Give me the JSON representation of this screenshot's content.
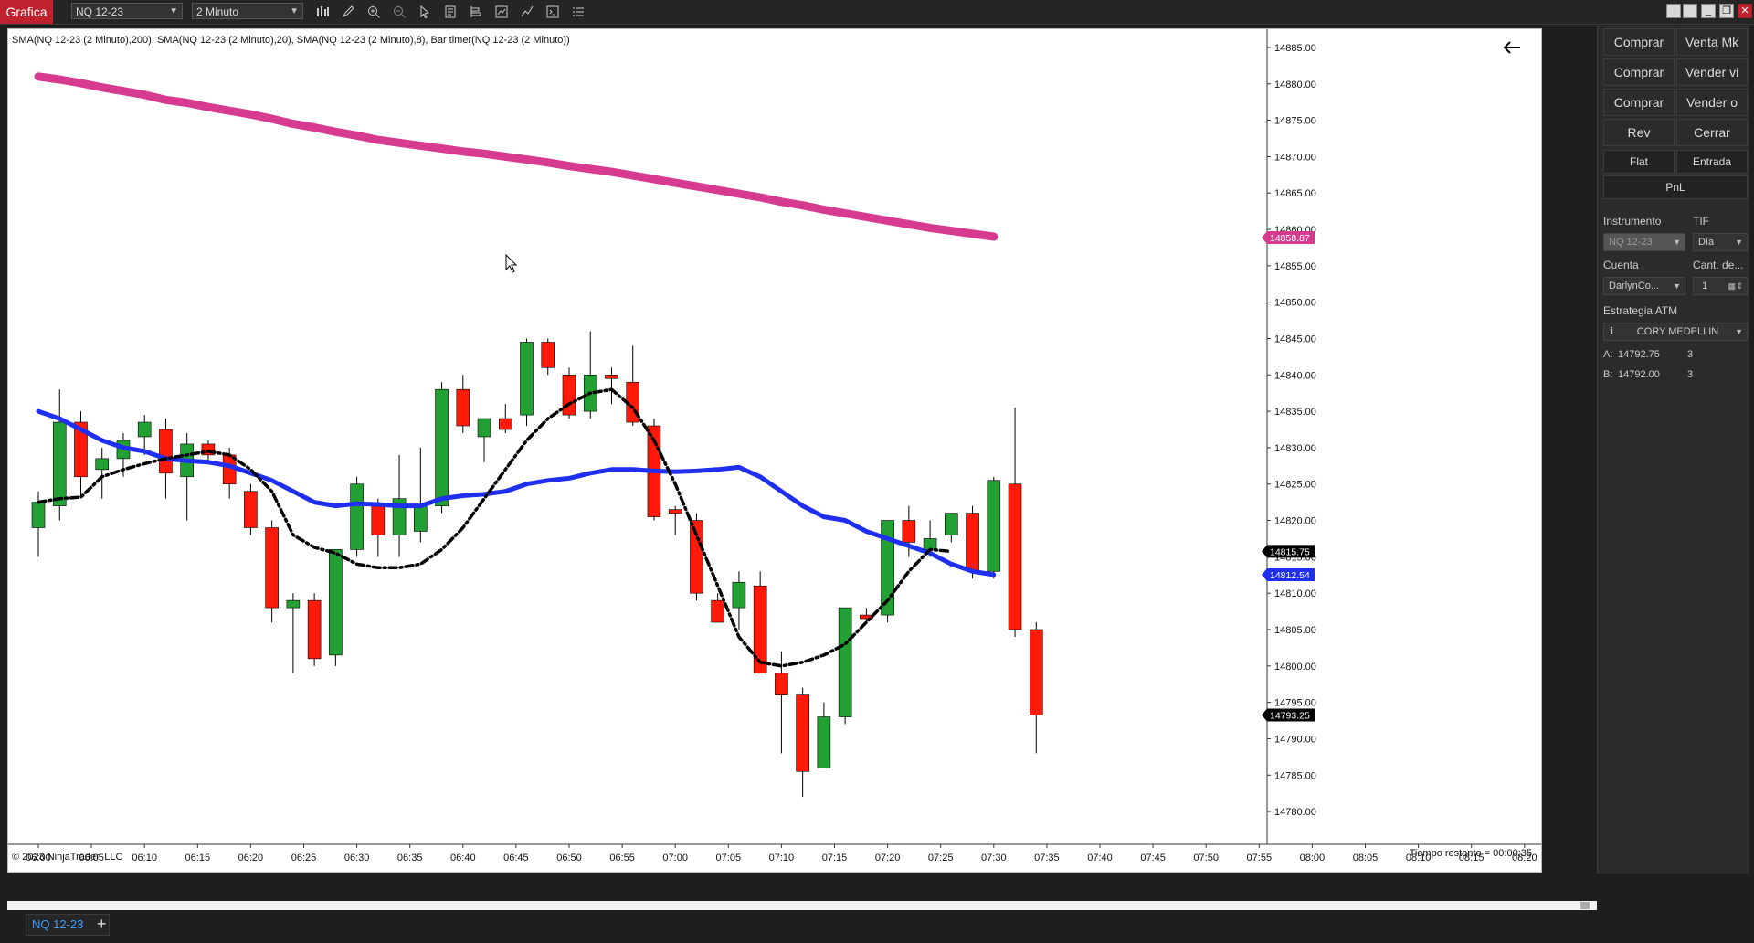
{
  "app": {
    "title": "Grafica"
  },
  "toolbar": {
    "instrument": "NQ 12-23",
    "interval": "2 Minuto",
    "tools": [
      "bars-icon",
      "pencil-icon",
      "zoom-in-icon",
      "zoom-out-icon",
      "cursor-icon",
      "template-icon",
      "properties-icon",
      "data-box-icon",
      "strategy-icon",
      "chart-trader-icon",
      "more-icon"
    ]
  },
  "chart": {
    "legend_text": "SMA(NQ 12-23 (2 Minuto),200), SMA(NQ 12-23 (2 Minuto),20), SMA(NQ 12-23 (2 Minuto),8), Bar timer(NQ 12-23 (2 Minuto))",
    "copyright": "© 2023 NinjaTrader, LLC",
    "bar_timer": "Tiempo restante = 00:00:35",
    "colors": {
      "up": "#22a033",
      "down": "#ff1a0a",
      "sma200": "#d63b8f",
      "sma20": "#1f2ff0",
      "sma8": "#000000"
    }
  },
  "chart_data": {
    "type": "candlestick",
    "instrument": "NQ 12-23",
    "interval": "2 Minuto",
    "yticks": [
      "14885.00",
      "14880.00",
      "14875.00",
      "14870.00",
      "14865.00",
      "14860.00",
      "14855.00",
      "14850.00",
      "14845.00",
      "14840.00",
      "14835.00",
      "14830.00",
      "14825.00",
      "14820.00",
      "14815.00",
      "14810.00",
      "14805.00",
      "14800.00",
      "14795.00",
      "14790.00",
      "14785.00",
      "14780.00"
    ],
    "ylim": [
      14778,
      14886.5
    ],
    "xticks": [
      "06:00",
      "06:05",
      "06:10",
      "06:15",
      "06:20",
      "06:25",
      "06:30",
      "06:35",
      "06:40",
      "06:45",
      "06:50",
      "06:55",
      "07:00",
      "07:05",
      "07:10",
      "07:15",
      "07:20",
      "07:25",
      "07:30",
      "07:35",
      "07:40",
      "07:45",
      "07:50",
      "07:55",
      "08:00",
      "08:05",
      "08:10",
      "08:15",
      "08:20"
    ],
    "candles": [
      {
        "time": "06:00",
        "open": 14819,
        "high": 14824,
        "low": 14815,
        "close": 14822.5
      },
      {
        "time": "06:02",
        "open": 14822,
        "high": 14838,
        "low": 14820,
        "close": 14833.5
      },
      {
        "time": "06:04",
        "open": 14833.5,
        "high": 14835,
        "low": 14823,
        "close": 14826
      },
      {
        "time": "06:06",
        "open": 14827,
        "high": 14830,
        "low": 14823,
        "close": 14828.5
      },
      {
        "time": "06:08",
        "open": 14828.5,
        "high": 14832,
        "low": 14826,
        "close": 14831
      },
      {
        "time": "06:10",
        "open": 14831.5,
        "high": 14834.5,
        "low": 14829,
        "close": 14833.5
      },
      {
        "time": "06:12",
        "open": 14832.5,
        "high": 14834,
        "low": 14823,
        "close": 14826.5
      },
      {
        "time": "06:14",
        "open": 14826,
        "high": 14832,
        "low": 14820,
        "close": 14830.5
      },
      {
        "time": "06:16",
        "open": 14830.5,
        "high": 14831,
        "low": 14828,
        "close": 14829
      },
      {
        "time": "06:18",
        "open": 14829,
        "high": 14830,
        "low": 14823,
        "close": 14825
      },
      {
        "time": "06:20",
        "open": 14824,
        "high": 14825,
        "low": 14818,
        "close": 14819
      },
      {
        "time": "06:22",
        "open": 14819,
        "high": 14820,
        "low": 14806,
        "close": 14808
      },
      {
        "time": "06:24",
        "open": 14808,
        "high": 14810,
        "low": 14799,
        "close": 14809
      },
      {
        "time": "06:26",
        "open": 14809,
        "high": 14810,
        "low": 14800,
        "close": 14801
      },
      {
        "time": "06:28",
        "open": 14801.5,
        "high": 14811,
        "low": 14800,
        "close": 14816
      },
      {
        "time": "06:30",
        "open": 14816,
        "high": 14826,
        "low": 14815,
        "close": 14825
      },
      {
        "time": "06:32",
        "open": 14822,
        "high": 14823,
        "low": 14815,
        "close": 14818
      },
      {
        "time": "06:34",
        "open": 14818,
        "high": 14829,
        "low": 14815,
        "close": 14823
      },
      {
        "time": "06:36",
        "open": 14818.5,
        "high": 14830,
        "low": 14817,
        "close": 14822
      },
      {
        "time": "06:38",
        "open": 14822,
        "high": 14839,
        "low": 14821,
        "close": 14838
      },
      {
        "time": "06:40",
        "open": 14838,
        "high": 14840,
        "low": 14832,
        "close": 14833
      },
      {
        "time": "06:42",
        "open": 14831.5,
        "high": 14834,
        "low": 14828,
        "close": 14834
      },
      {
        "time": "06:44",
        "open": 14834,
        "high": 14836,
        "low": 14832,
        "close": 14832.5
      },
      {
        "time": "06:46",
        "open": 14834.5,
        "high": 14845,
        "low": 14833,
        "close": 14844.5
      },
      {
        "time": "06:48",
        "open": 14844.5,
        "high": 14845,
        "low": 14840,
        "close": 14841
      },
      {
        "time": "06:50",
        "open": 14840,
        "high": 14841,
        "low": 14834,
        "close": 14834.5
      },
      {
        "time": "06:52",
        "open": 14835,
        "high": 14846,
        "low": 14834,
        "close": 14840
      },
      {
        "time": "06:54",
        "open": 14840,
        "high": 14841,
        "low": 14836,
        "close": 14839.5
      },
      {
        "time": "06:56",
        "open": 14839,
        "high": 14844,
        "low": 14833,
        "close": 14833.5
      },
      {
        "time": "06:58",
        "open": 14833,
        "high": 14834,
        "low": 14820,
        "close": 14820.5
      },
      {
        "time": "07:00",
        "open": 14821.5,
        "high": 14822,
        "low": 14818,
        "close": 14821
      },
      {
        "time": "07:02",
        "open": 14820,
        "high": 14821,
        "low": 14809,
        "close": 14810
      },
      {
        "time": "07:04",
        "open": 14809,
        "high": 14810,
        "low": 14806,
        "close": 14806
      },
      {
        "time": "07:06",
        "open": 14808,
        "high": 14813,
        "low": 14805,
        "close": 14811.5
      },
      {
        "time": "07:08",
        "open": 14811,
        "high": 14813,
        "low": 14799,
        "close": 14799
      },
      {
        "time": "07:10",
        "open": 14799,
        "high": 14802,
        "low": 14788,
        "close": 14796
      },
      {
        "time": "07:12",
        "open": 14796,
        "high": 14797,
        "low": 14782,
        "close": 14785.5
      },
      {
        "time": "07:14",
        "open": 14786,
        "high": 14795,
        "low": 14786,
        "close": 14793
      },
      {
        "time": "07:16",
        "open": 14793,
        "high": 14808,
        "low": 14792,
        "close": 14808
      },
      {
        "time": "07:18",
        "open": 14807,
        "high": 14808,
        "low": 14806,
        "close": 14806.5
      },
      {
        "time": "07:20",
        "open": 14807,
        "high": 14820,
        "low": 14806,
        "close": 14820
      },
      {
        "time": "07:22",
        "open": 14820,
        "high": 14822,
        "low": 14815,
        "close": 14817
      },
      {
        "time": "07:24",
        "open": 14816,
        "high": 14820,
        "low": 14815,
        "close": 14817.5
      },
      {
        "time": "07:26",
        "open": 14818,
        "high": 14821,
        "low": 14817,
        "close": 14821
      },
      {
        "time": "07:28",
        "open": 14821,
        "high": 14822,
        "low": 14812,
        "close": 14813
      },
      {
        "time": "07:30",
        "open": 14813,
        "high": 14826,
        "low": 14812,
        "close": 14825.5
      },
      {
        "time": "07:32",
        "open": 14825,
        "high": 14835.5,
        "low": 14804,
        "close": 14805
      },
      {
        "time": "07:34",
        "open": 14805,
        "high": 14806,
        "low": 14788,
        "close": 14793.25
      }
    ],
    "series": [
      {
        "name": "SMA(NQ 12-23 (2 Minuto),200)",
        "values": [
          14881,
          14880.6,
          14880.1,
          14879.5,
          14879,
          14878.5,
          14877.8,
          14877.4,
          14876.8,
          14876.3,
          14875.8,
          14875.2,
          14874.5,
          14874.0,
          14873.4,
          14872.9,
          14872.3,
          14871.9,
          14871.5,
          14871.1,
          14870.7,
          14870.4,
          14870.0,
          14869.6,
          14869.2,
          14868.7,
          14868.3,
          14867.9,
          14867.4,
          14866.9,
          14866.4,
          14865.9,
          14865.4,
          14864.9,
          14864.4,
          14863.8,
          14863.3,
          14862.7,
          14862.2,
          14861.7,
          14861.2,
          14860.7,
          14860.2,
          14859.8,
          14859.4,
          14859
        ]
      },
      {
        "name": "SMA(NQ 12-23 (2 Minuto),20)",
        "values": [
          14835,
          14834,
          14832.5,
          14831,
          14830,
          14829.5,
          14828.5,
          14828.2,
          14828,
          14827.5,
          14826.5,
          14825.5,
          14824,
          14822.5,
          14822,
          14822.3,
          14822.2,
          14822,
          14822,
          14823,
          14823.4,
          14823.6,
          14824,
          14825,
          14825.5,
          14825.8,
          14826.5,
          14827,
          14827,
          14826.8,
          14826.7,
          14826.8,
          14827,
          14827.3,
          14826,
          14824,
          14822,
          14820.5,
          14820,
          14818.5,
          14817.5,
          14816.5,
          14815.5,
          14814,
          14813,
          14812.54
        ]
      },
      {
        "name": "SMA(NQ 12-23 (2 Minuto),8)",
        "values": [
          14822.5,
          14823,
          14823.2,
          14826,
          14827,
          14827.8,
          14828.5,
          14829,
          14829.5,
          14829,
          14827,
          14824,
          14818,
          14816.3,
          14815.5,
          14814,
          14813.5,
          14813.5,
          14814,
          14816,
          14819,
          14823,
          14827,
          14831,
          14834,
          14836,
          14837.5,
          14838,
          14835.5,
          14831,
          14825,
          14818,
          14811,
          14804,
          14800.5,
          14800,
          14800.5,
          14801.5,
          14803,
          14806,
          14809,
          14813,
          14816,
          14815.75
        ]
      }
    ],
    "price_markers": [
      {
        "label": "14858.87",
        "value": 14858.87,
        "color": "#d63b8f"
      },
      {
        "label": "14815.75",
        "value": 14815.75,
        "color": "#000000"
      },
      {
        "label": "14812.54",
        "value": 14812.54,
        "color": "#1f2ff0"
      },
      {
        "label": "14793.25",
        "value": 14793.25,
        "color": "#000000"
      }
    ]
  },
  "panel": {
    "buttons": [
      {
        "label": "Comprar"
      },
      {
        "label": "Venta Mk"
      },
      {
        "label": "Comprar"
      },
      {
        "label": "Vender vi"
      },
      {
        "label": "Comprar"
      },
      {
        "label": "Vender o"
      },
      {
        "label": "Rev"
      },
      {
        "label": "Cerrar"
      }
    ],
    "flat_label": "Flat",
    "entrada_label": "Entrada",
    "pnl_label": "PnL",
    "instrumento_label": "Instrumento",
    "tif_label": "TIF",
    "instrument_value": "NQ 12-23",
    "tif_value": "Día",
    "cuenta_label": "Cuenta",
    "cantidad_label": "Cant. de...",
    "cuenta_value": "DarlynCo...",
    "cantidad_value": "1",
    "estrategia_label": "Estrategia ATM",
    "estrategia_value": "CORY MEDELLIN",
    "ask": {
      "label": "A:",
      "price": "14792.75",
      "size": "3"
    },
    "bid": {
      "label": "B:",
      "price": "14792.00",
      "size": "3"
    }
  },
  "bottom_tab": {
    "label": "NQ 12-23",
    "add_label": "+"
  }
}
